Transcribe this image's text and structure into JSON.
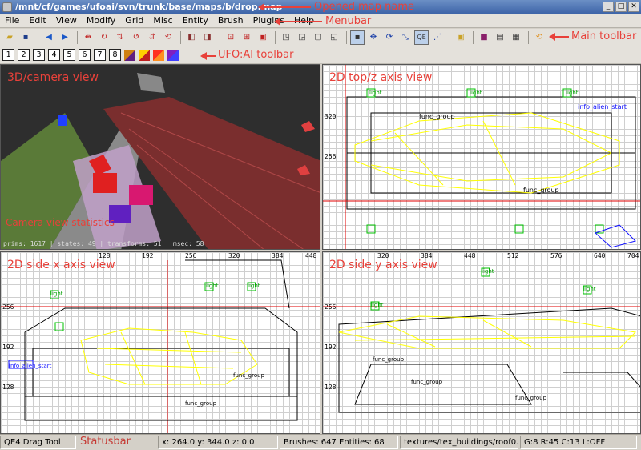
{
  "window": {
    "title": "/mnt/cf/games/ufoai/svn/trunk/base/maps/b/drop.map",
    "buttons": [
      "_",
      "□",
      "✕"
    ]
  },
  "menubar": {
    "items": [
      "File",
      "Edit",
      "View",
      "Modify",
      "Grid",
      "Misc",
      "Entity",
      "Brush",
      "Plugins",
      "Help"
    ]
  },
  "ufo_toolbar": {
    "numbers": [
      "1",
      "2",
      "3",
      "4",
      "5",
      "6",
      "7",
      "8"
    ]
  },
  "annotations": {
    "opened_map": "Opened map name",
    "menubar": "Menubar",
    "main_toolbar": "Main toolbar",
    "ufo_toolbar": "UFO:AI toolbar",
    "camera_stats": "Camera view statistics",
    "statusbar": "Statusbar"
  },
  "views": {
    "camera": {
      "title": "3D/camera view",
      "stats": "prims: 1617 | states: 49 | transforms: 51 | msec: 58"
    },
    "top": {
      "title": "2D top/z axis view",
      "ruler": [
        "256",
        "320"
      ],
      "labels": [
        "func_group",
        "light",
        "info_alien_start",
        "func_group",
        "light",
        "light"
      ]
    },
    "side_x": {
      "title": "2D side x axis view",
      "ruler": [
        "128",
        "192",
        "256",
        "320",
        "384",
        "448"
      ],
      "vruler": [
        "256",
        "192",
        "128"
      ],
      "labels": [
        "light",
        "light",
        "light",
        "info_alien_start",
        "func_group",
        "func_group"
      ]
    },
    "side_y": {
      "title": "2D side y axis view",
      "ruler": [
        "320",
        "384",
        "448",
        "512",
        "576",
        "640",
        "704"
      ],
      "vruler": [
        "256",
        "192",
        "128"
      ],
      "labels": [
        "light",
        "light",
        "light",
        "func_group",
        "func_group",
        "func_group"
      ]
    }
  },
  "statusbar": {
    "tool": "QE4 Drag Tool",
    "coords": "x:   264.0  y:   344.0  z:     0.0",
    "counts": "Brushes: 647 Entities: 68",
    "texture": "textures/tex_buildings/roof0...",
    "grid": "G:8  R:45  C:13  L:OFF"
  },
  "colors": {
    "annotation": "#e8413a",
    "brush_yellow": "#ffff00",
    "entity_green": "#00c000",
    "crosshair_red": "#e00000",
    "selection_blue": "#1010ff"
  }
}
